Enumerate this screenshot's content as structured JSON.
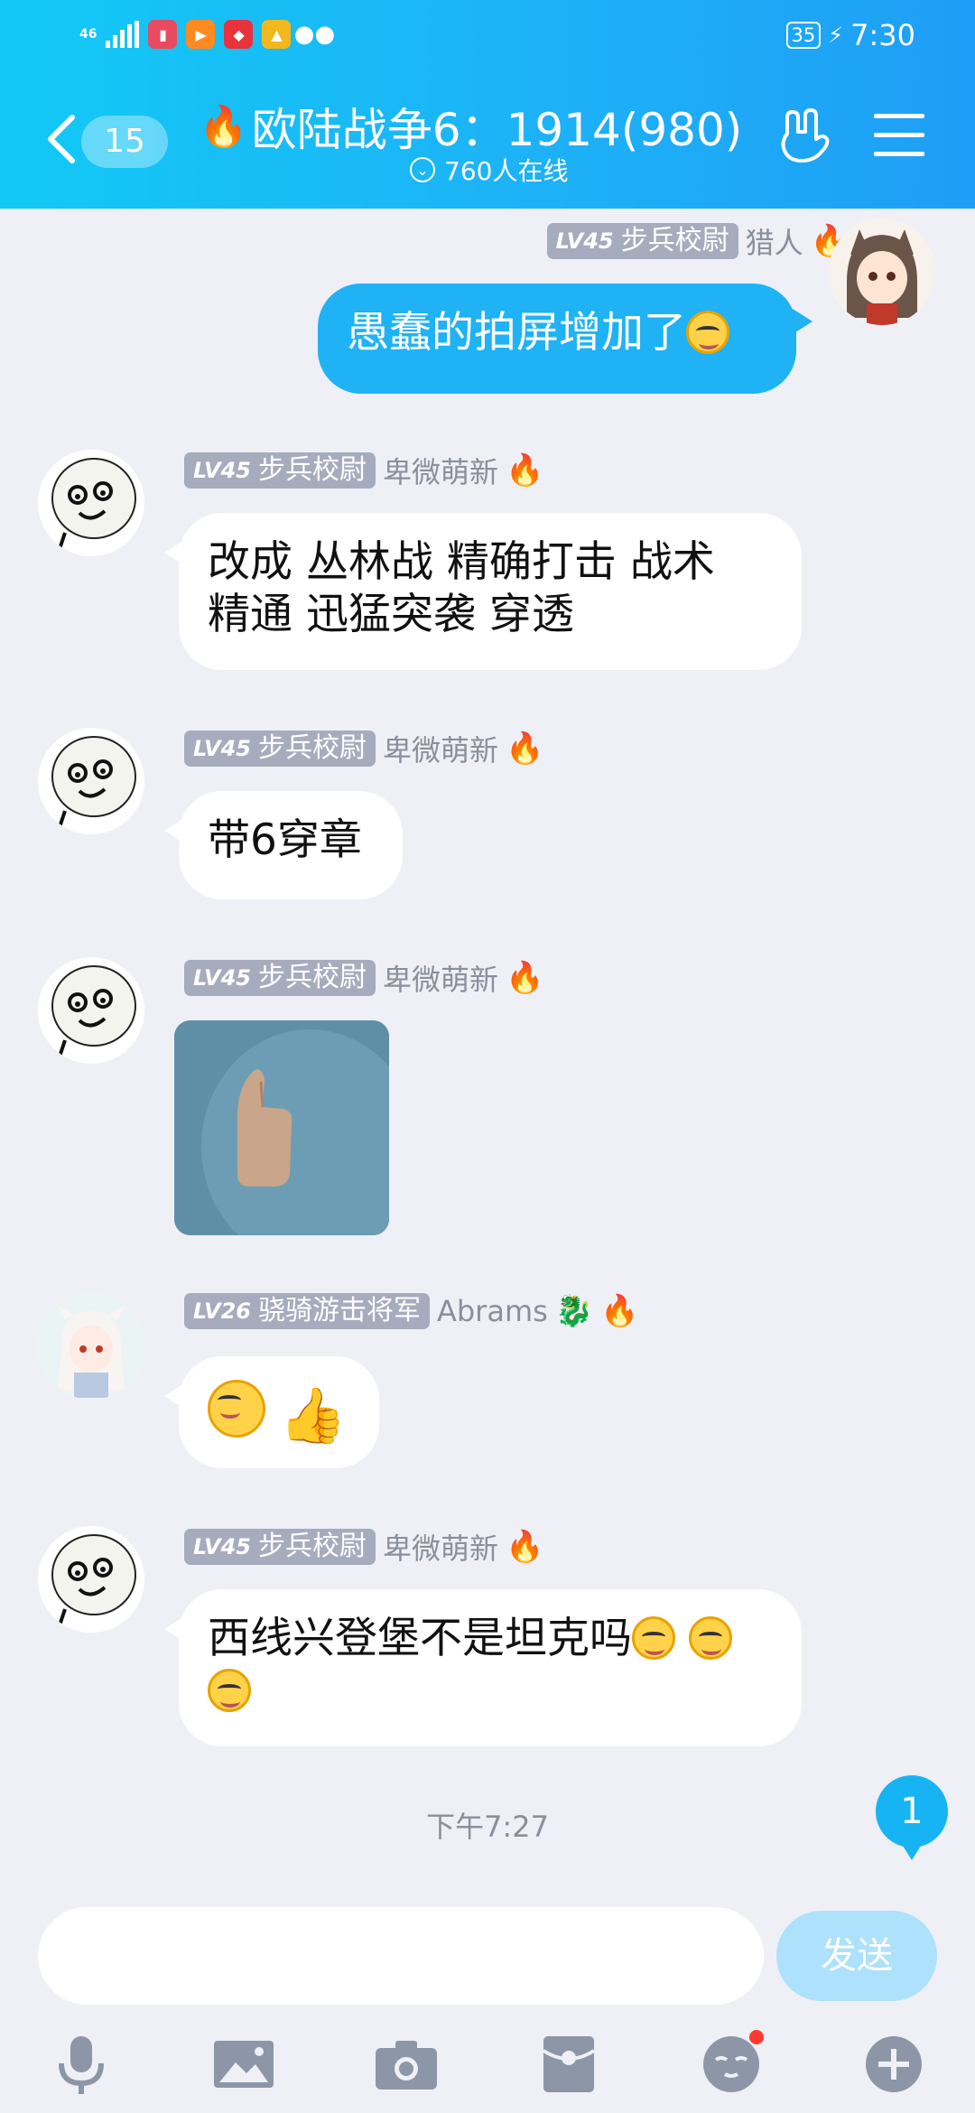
{
  "status_bar": {
    "network": "46",
    "time": "7:30",
    "battery": "35"
  },
  "header": {
    "back_count": "15",
    "title": "欧陆战争6：1914(980)",
    "online_text": "760人在线"
  },
  "messages": [
    {
      "side": "right",
      "level": "LV45",
      "rank": "步兵校尉",
      "nickname": "猎人",
      "text": "愚蠢的拍屏增加了"
    },
    {
      "side": "left",
      "level": "LV45",
      "rank": "步兵校尉",
      "nickname": "卑微萌新",
      "line1": "改成 丛林战 精确打击 战术",
      "line2": "精通 迅猛突袭 穿透"
    },
    {
      "side": "left",
      "level": "LV45",
      "rank": "步兵校尉",
      "nickname": "卑微萌新",
      "text": "带6穿章"
    },
    {
      "side": "left",
      "level": "LV45",
      "rank": "步兵校尉",
      "nickname": "卑微萌新",
      "type": "image"
    },
    {
      "side": "left",
      "level": "LV26",
      "rank": "骁骑游击将军",
      "nickname": "Abrams",
      "type": "emoji"
    },
    {
      "side": "left",
      "level": "LV45",
      "rank": "步兵校尉",
      "nickname": "卑微萌新",
      "text": "西线兴登堡不是坦克吗"
    }
  ],
  "timestamp": "下午7:27",
  "unread_count": "1",
  "composer": {
    "placeholder": "",
    "send_label": "发送"
  },
  "toolbar": [
    "microphone-icon",
    "image-icon",
    "camera-icon",
    "red-packet-icon",
    "emoji-icon",
    "plus-icon"
  ],
  "colors": {
    "header_start": "#12c9f5",
    "header_end": "#1e9ef6",
    "my_bubble": "#1fb2f5",
    "background": "#eef0f6",
    "level_badge": "#a6acbd"
  }
}
